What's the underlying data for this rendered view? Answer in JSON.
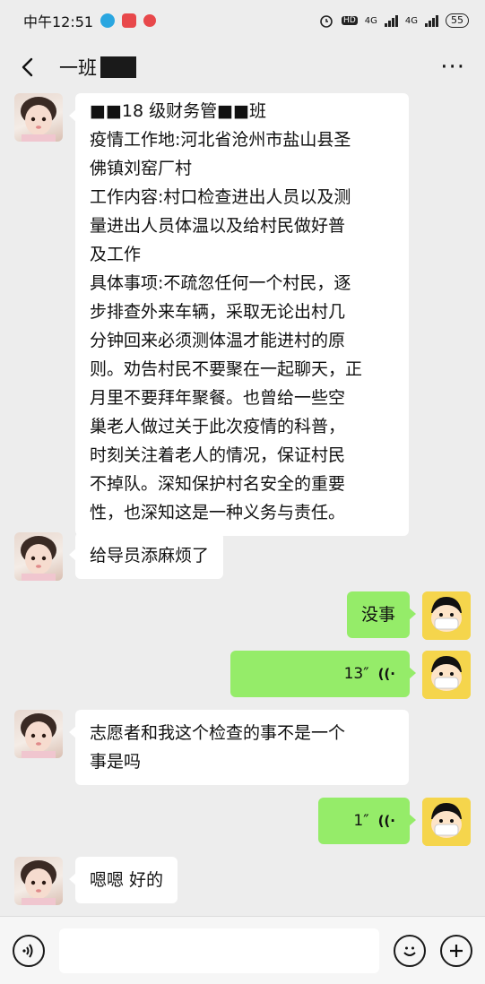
{
  "status_bar": {
    "time": "中午12:51",
    "hd": "HD",
    "network_1": "4G",
    "network_2": "4G",
    "battery": "55"
  },
  "header": {
    "title": "一班",
    "back_icon": "chevron-left-icon",
    "more_icon": "more-dots-icon",
    "more_label": "···"
  },
  "messages": [
    {
      "side": "in",
      "lines": [
        "■■18 级财务管■■班",
        "疫情工作地:河北省沧州市盐山县圣",
        "佛镇刘窑厂村",
        "工作内容:村口检查进出人员以及测",
        "量进出人员体温以及给村民做好普",
        "及工作",
        "具体事项:不疏忽任何一个村民，逐",
        "步排查外来车辆，采取无论出村几",
        "分钟回来必须测体温才能进村的原",
        "则。劝告村民不要聚在一起聊天，正",
        "月里不要拜年聚餐。也曾给一些空",
        "巢老人做过关于此次疫情的科普，",
        "时刻关注着老人的情况，保证村民",
        "不掉队。深知保护村名安全的重要",
        "性，也深知这是一种义务与责任。"
      ]
    },
    {
      "side": "in",
      "text": "给导员添麻烦了"
    },
    {
      "side": "out",
      "text": "没事"
    },
    {
      "side": "out",
      "voice": true,
      "duration": "13″"
    },
    {
      "side": "in",
      "lines": [
        "志愿者和我这个检查的事不是一个",
        "事是吗"
      ]
    },
    {
      "side": "out",
      "voice": true,
      "duration": "1″"
    },
    {
      "side": "in",
      "text": "嗯嗯 好的"
    }
  ],
  "bottom_bar": {
    "voice_icon": "voice-toggle-icon",
    "input_value": "",
    "emoji_icon": "emoji-icon",
    "plus_icon": "plus-icon"
  },
  "colors": {
    "background": "#ededed",
    "outgoing_bubble": "#95ec69",
    "incoming_bubble": "#ffffff"
  }
}
